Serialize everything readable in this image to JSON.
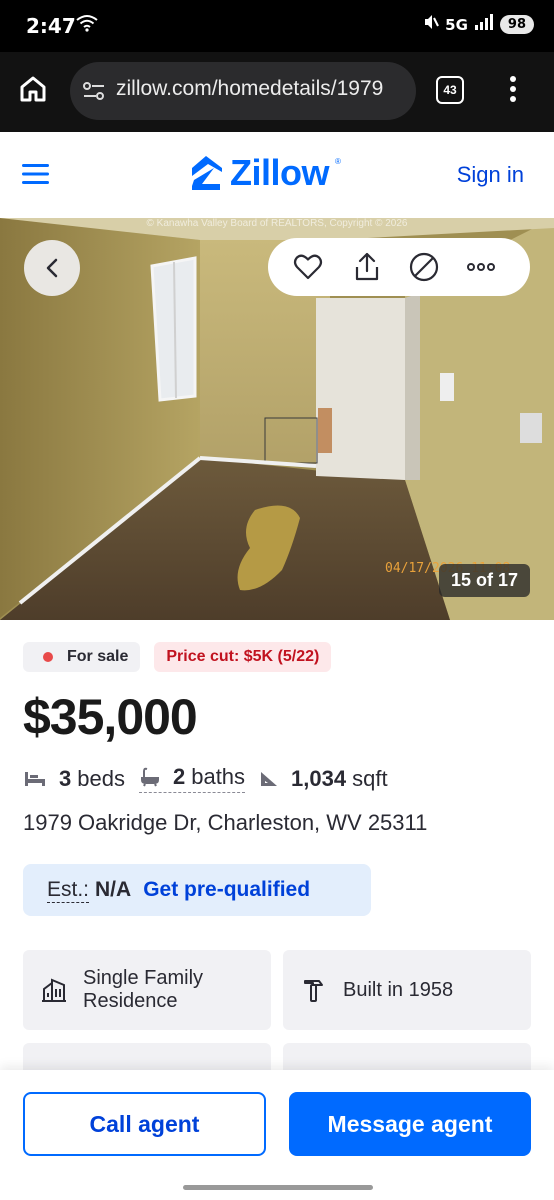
{
  "status_bar": {
    "time": "2:47",
    "network": "5G",
    "battery": "98"
  },
  "browser": {
    "url": "zillow.com/homedetails/1979",
    "tab_count": "43"
  },
  "header": {
    "logo": "Zillow",
    "sign_in": "Sign in"
  },
  "photo": {
    "copyright": "© Kanawha Valley Board of REALTORS, Copyright © 2026",
    "date_stamp": "04/17/2026 11:08",
    "counter": "15 of 17"
  },
  "listing": {
    "status_badge": "For sale",
    "price_cut": "Price cut: $5K (5/22)",
    "price": "$35,000",
    "beds_num": "3",
    "beds_label": "beds",
    "baths_num": "2",
    "baths_label": "baths",
    "sqft_num": "1,034",
    "sqft_label": "sqft",
    "address": "1979 Oakridge Dr, Charleston, WV 25311",
    "est_label": "Est.:",
    "est_value": "N/A",
    "prequal": "Get pre-qualified"
  },
  "facts_cards": {
    "type": "Single Family Residence",
    "built": "Built in 1958"
  },
  "bottom_bar": {
    "call_agent": "Call agent",
    "message_agent": "Message agent"
  },
  "colors": {
    "brand": "#006aff",
    "link": "#0041d9",
    "sale_dot": "#e84a4a",
    "price_cut": "#c1121f"
  }
}
